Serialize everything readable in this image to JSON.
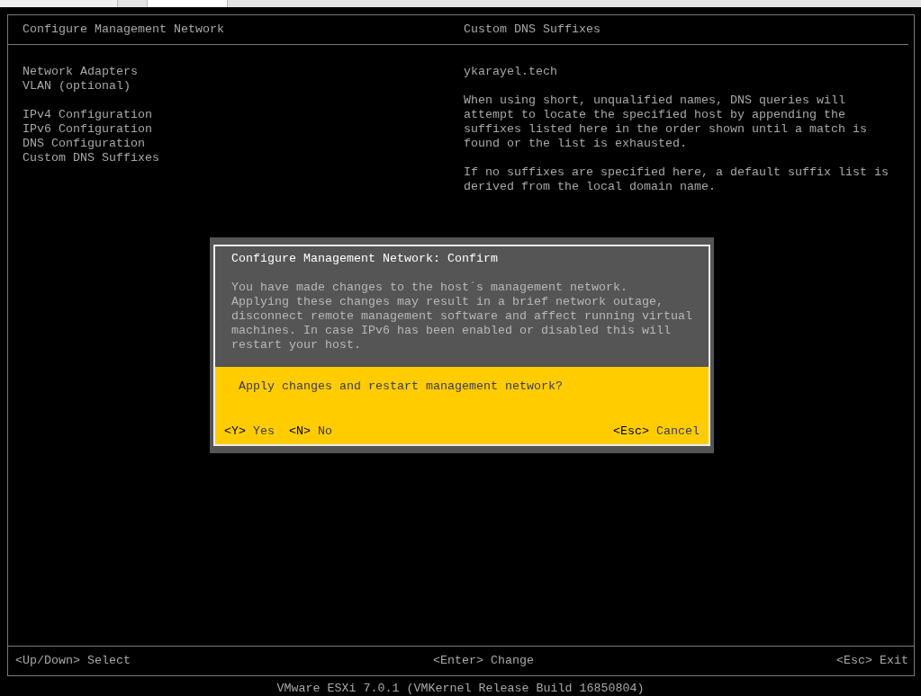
{
  "header": {
    "left_title": "Configure Management Network",
    "right_title": "Custom DNS Suffixes"
  },
  "menu_groups": [
    [
      "Network Adapters",
      "VLAN (optional)"
    ],
    [
      "IPv4 Configuration",
      "IPv6 Configuration",
      "DNS Configuration",
      "Custom DNS Suffixes"
    ]
  ],
  "detail": {
    "value": "ykarayel.tech",
    "paragraphs": [
      "When using short, unqualified names, DNS queries will\nattempt to locate the specified host by appending the\nsuffixes listed here in the order shown until a match is\nfound or the list is exhausted.",
      "If no suffixes are specified here, a default suffix list is\nderived from the local domain name."
    ]
  },
  "dialog": {
    "title": "Configure Management Network: Confirm",
    "message": "You have made changes to the host´s management network.\nApplying these changes may result in a brief network outage,\ndisconnect remote management software and affect running virtual\nmachines. In case IPv6 has been enabled or disabled this will\nrestart your host.",
    "question": "Apply changes and restart management network?",
    "left_actions": [
      {
        "key": "<Y>",
        "label": "Yes"
      },
      {
        "key": "<N>",
        "label": "No"
      }
    ],
    "right_actions": [
      {
        "key": "<Esc>",
        "label": "Cancel"
      }
    ]
  },
  "footer": [
    {
      "key": "<Up/Down>",
      "label": "Select"
    },
    {
      "key": "<Enter>",
      "label": "Change"
    },
    {
      "key": "<Esc>",
      "label": "Exit"
    }
  ],
  "version": "VMware ESXi 7.0.1 (VMKernel Release Build 16850804)"
}
